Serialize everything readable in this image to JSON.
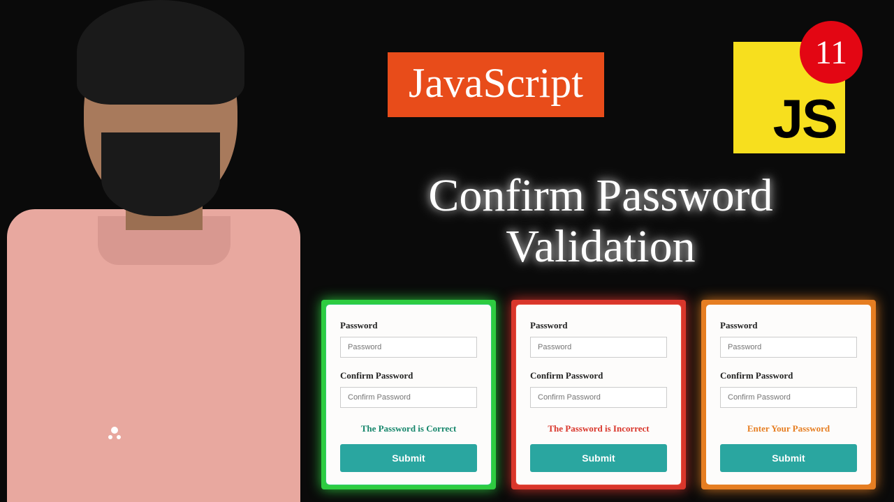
{
  "header": {
    "badge_text": "JavaScript",
    "logo_text": "JS",
    "episode_number": "11"
  },
  "title": {
    "line1": "Confirm Password",
    "line2": "Validation"
  },
  "form": {
    "password_label": "Password",
    "password_placeholder": "Password",
    "confirm_label": "Confirm Password",
    "confirm_placeholder": "Confirm Password",
    "submit_label": "Submit"
  },
  "cards": [
    {
      "status": "The Password is Correct",
      "tone": "ok"
    },
    {
      "status": "The Password is Incorrect",
      "tone": "err"
    },
    {
      "status": "Enter Your Password",
      "tone": "warn"
    }
  ]
}
